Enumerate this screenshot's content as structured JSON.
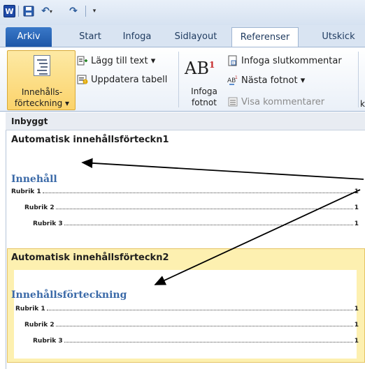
{
  "quick_access": {
    "word_icon": "W",
    "undo_glyph": "↶",
    "redo_glyph": "↷",
    "dropdown_glyph": "▾",
    "customize_glyph": "▾"
  },
  "tabs": [
    {
      "label": "Arkiv"
    },
    {
      "label": "Start"
    },
    {
      "label": "Infoga"
    },
    {
      "label": "Sidlayout"
    },
    {
      "label": "Referenser"
    },
    {
      "label": "Utskick"
    }
  ],
  "ribbon": {
    "toc_button": {
      "line1": "Innehålls-",
      "line2": "förteckning ▾"
    },
    "add_text": "Lägg till text ▾",
    "update_table": "Uppdatera tabell",
    "insert_footnote": {
      "line1": "Infoga",
      "line2": "fotnot"
    },
    "ab_glyph": "AB",
    "ab_sup": "1",
    "insert_endnote": "Infoga slutkommentar",
    "next_footnote": "Nästa fotnot ▾",
    "show_notes": "Visa kommentarer",
    "truncated_group": "k"
  },
  "gallery": {
    "header": "Inbyggt",
    "items": [
      {
        "title": "Automatisk innehållsförteckn1",
        "heading": "Innehåll",
        "rows": [
          {
            "text": "Rubrik 1",
            "page": "1"
          },
          {
            "text": "Rubrik 2",
            "page": "1"
          },
          {
            "text": "Rubrik 3",
            "page": "1"
          }
        ]
      },
      {
        "title": "Automatisk innehållsförteckn2",
        "heading": "Innehållsförteckning",
        "rows": [
          {
            "text": "Rubrik 1",
            "page": "1"
          },
          {
            "text": "Rubrik 2",
            "page": "1"
          },
          {
            "text": "Rubrik 3",
            "page": "1"
          }
        ]
      }
    ]
  },
  "colors": {
    "accent_blue": "#3b6aa8",
    "selected_highlight": "#fdf0b0",
    "file_tab": "#1d56a6"
  }
}
